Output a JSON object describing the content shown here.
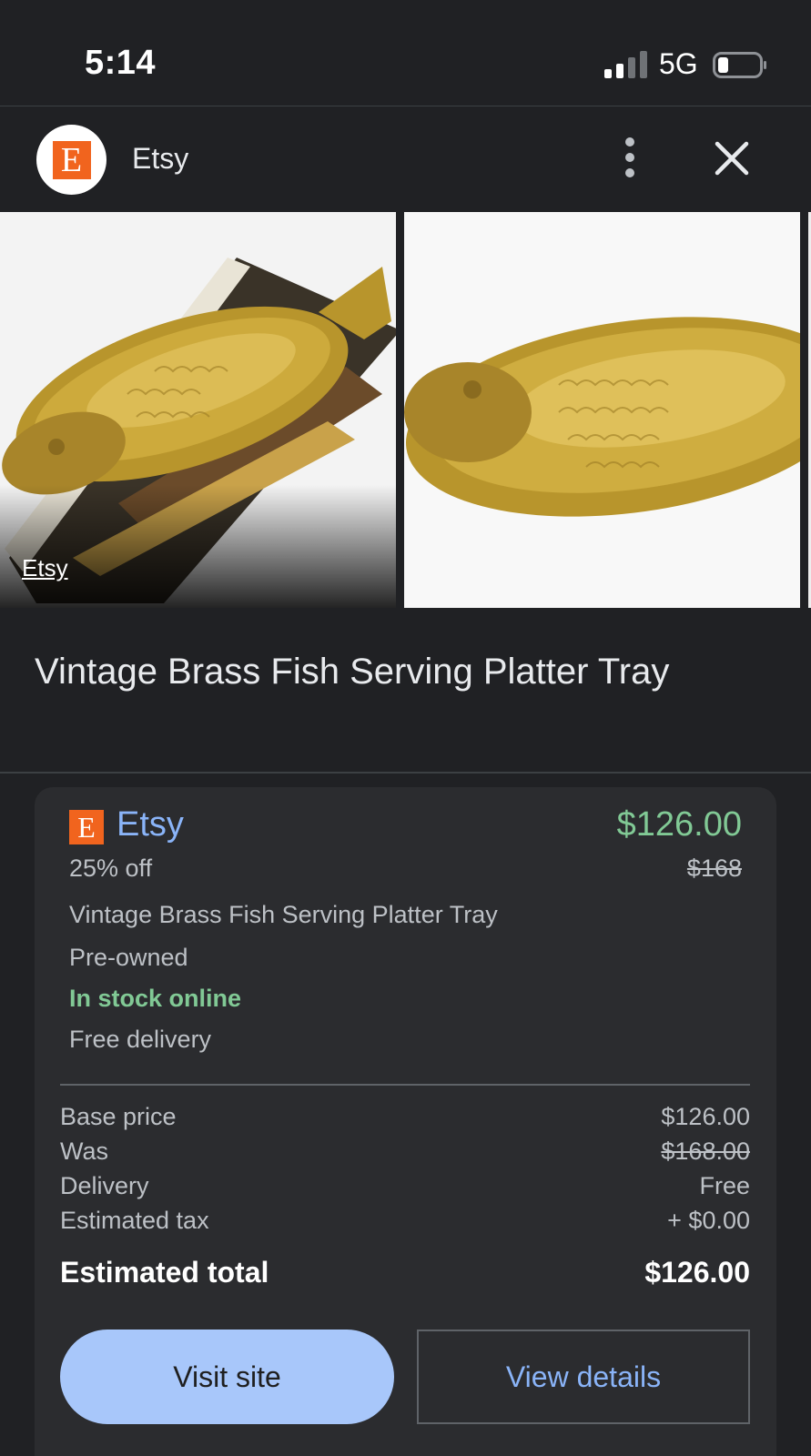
{
  "status_bar": {
    "time": "5:14",
    "network": "5G",
    "signal_bars_active": 2,
    "signal_bars_total": 4,
    "icons": [
      "signal-icon",
      "battery-icon"
    ]
  },
  "header": {
    "logo_letter": "E",
    "title": "Etsy",
    "icons": [
      "more-vert-icon",
      "close-icon"
    ]
  },
  "images": {
    "source_label": "Etsy",
    "items": [
      "brass-fish-on-book-photo",
      "brass-fish-white-background-photo",
      "partial-third-photo"
    ]
  },
  "product": {
    "title": "Vintage Brass Fish Serving Platter Tray"
  },
  "offer": {
    "seller_logo_letter": "E",
    "seller_name": "Etsy",
    "price": "$126.00",
    "discount": "25% off",
    "original_price": "$168",
    "title": "Vintage Brass Fish Serving Platter Tray",
    "condition": "Pre-owned",
    "stock": "In stock online",
    "delivery": "Free delivery",
    "breakdown": [
      {
        "label": "Base price",
        "value": "$126.00"
      },
      {
        "label": "Was",
        "value": "$168.00"
      },
      {
        "label": "Delivery",
        "value": "Free"
      },
      {
        "label": "Estimated tax",
        "value": "+ $0.00"
      }
    ],
    "total_label": "Estimated total",
    "total_value": "$126.00",
    "visit_button": "Visit site",
    "details_button": "View details"
  },
  "colors": {
    "background": "#202124",
    "card": "#2b2c2f",
    "accent_blue": "#8ab4f8",
    "button_blue": "#a8c7fa",
    "price_green": "#81c995",
    "etsy_orange": "#f1641e"
  }
}
